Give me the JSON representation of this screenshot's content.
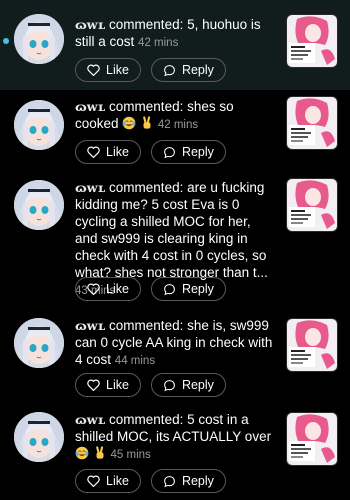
{
  "actions": {
    "like_label": "Like",
    "reply_label": "Reply"
  },
  "notifications": [
    {
      "user": "ɷwʟ",
      "verb": "commented:",
      "text": "5, huohuo is still a cost",
      "time": "42 mins",
      "unread": true
    },
    {
      "user": "ɷwʟ",
      "verb": "commented:",
      "text": "shes so cooked",
      "emojis": [
        "face-with-tears-of-joy",
        "victory-hand"
      ],
      "time": "42 mins"
    },
    {
      "user": "ɷwʟ",
      "verb": "commented:",
      "text": "are u fucking kidding me? 5 cost Eva is 0 cycling a shilled MOC for her, and sw999 is clearing king in check with 4 cost in 0 cycles, so what? shes not stronger than t...",
      "time": "43 mins"
    },
    {
      "user": "ɷwʟ",
      "verb": "commented:",
      "text": "she is, sw999 can 0 cycle AA king in check with 4 cost",
      "time": "44 mins"
    },
    {
      "user": "ɷwʟ",
      "verb": "commented:",
      "text": "5 cost in a shilled MOC, its ACTUALLY over",
      "emojis": [
        "face-with-tears-of-joy",
        "victory-hand"
      ],
      "time": "45 mins"
    }
  ]
}
